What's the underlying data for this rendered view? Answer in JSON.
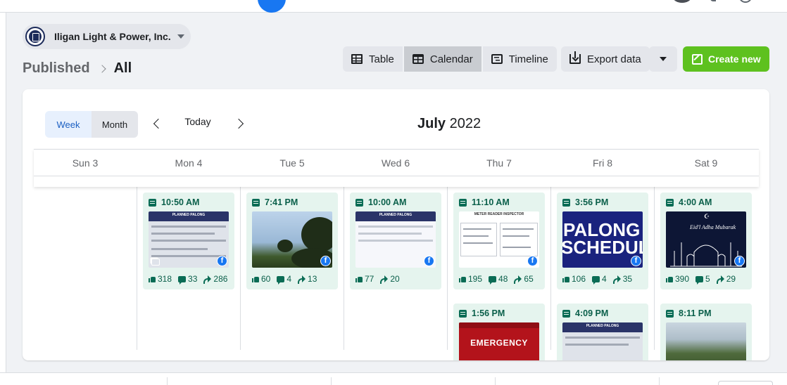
{
  "page": {
    "name": "Iligan Light & Power, Inc."
  },
  "breadcrumb": {
    "parent": "Published",
    "current": "All"
  },
  "toolbar": {
    "table_label": "Table",
    "calendar_label": "Calendar",
    "timeline_label": "Timeline",
    "export_label": "Export data",
    "create_label": "Create new",
    "active_view": "Calendar"
  },
  "calendar": {
    "week_label": "Week",
    "month_label": "Month",
    "active_range": "Week",
    "today_label": "Today",
    "month": "July",
    "year": "2022",
    "days": [
      "Sun 3",
      "Mon 4",
      "Tue 5",
      "Wed 6",
      "Thu 7",
      "Fri 8",
      "Sat 9"
    ]
  },
  "posts": {
    "mon_1": {
      "time": "10:50 AM",
      "likes": "318",
      "comments": "33",
      "shares": "286",
      "title": "PLANNED PALONG"
    },
    "tue_1": {
      "time": "7:41 PM",
      "likes": "60",
      "comments": "4",
      "shares": "13"
    },
    "wed_1": {
      "time": "10:00 AM",
      "likes": "77",
      "shares": "20",
      "title": "PLANNED PALONG"
    },
    "thu_1": {
      "time": "11:10 AM",
      "likes": "195",
      "comments": "48",
      "shares": "65",
      "title": "METER READER INSPECTOR"
    },
    "fri_1": {
      "time": "3:56 PM",
      "likes": "106",
      "comments": "4",
      "shares": "35",
      "line1": "PALONG",
      "line2": "SCHEDUL"
    },
    "sat_1": {
      "time": "4:00 AM",
      "likes": "390",
      "comments": "5",
      "shares": "29",
      "greeting": "Eid'l Adha Mubarak"
    },
    "thu_2": {
      "time": "1:56 PM",
      "title": "EMERGENCY"
    },
    "fri_2": {
      "time": "4:09 PM",
      "title": "PLANNED PALONG"
    },
    "sat_2": {
      "time": "8:11 PM"
    }
  },
  "colors": {
    "create_button": "#5ec11f",
    "post_bg": "#e5f4ee",
    "post_text": "#0a5f4a",
    "facebook": "#1877f2",
    "week_active": "#e7f0fd"
  }
}
